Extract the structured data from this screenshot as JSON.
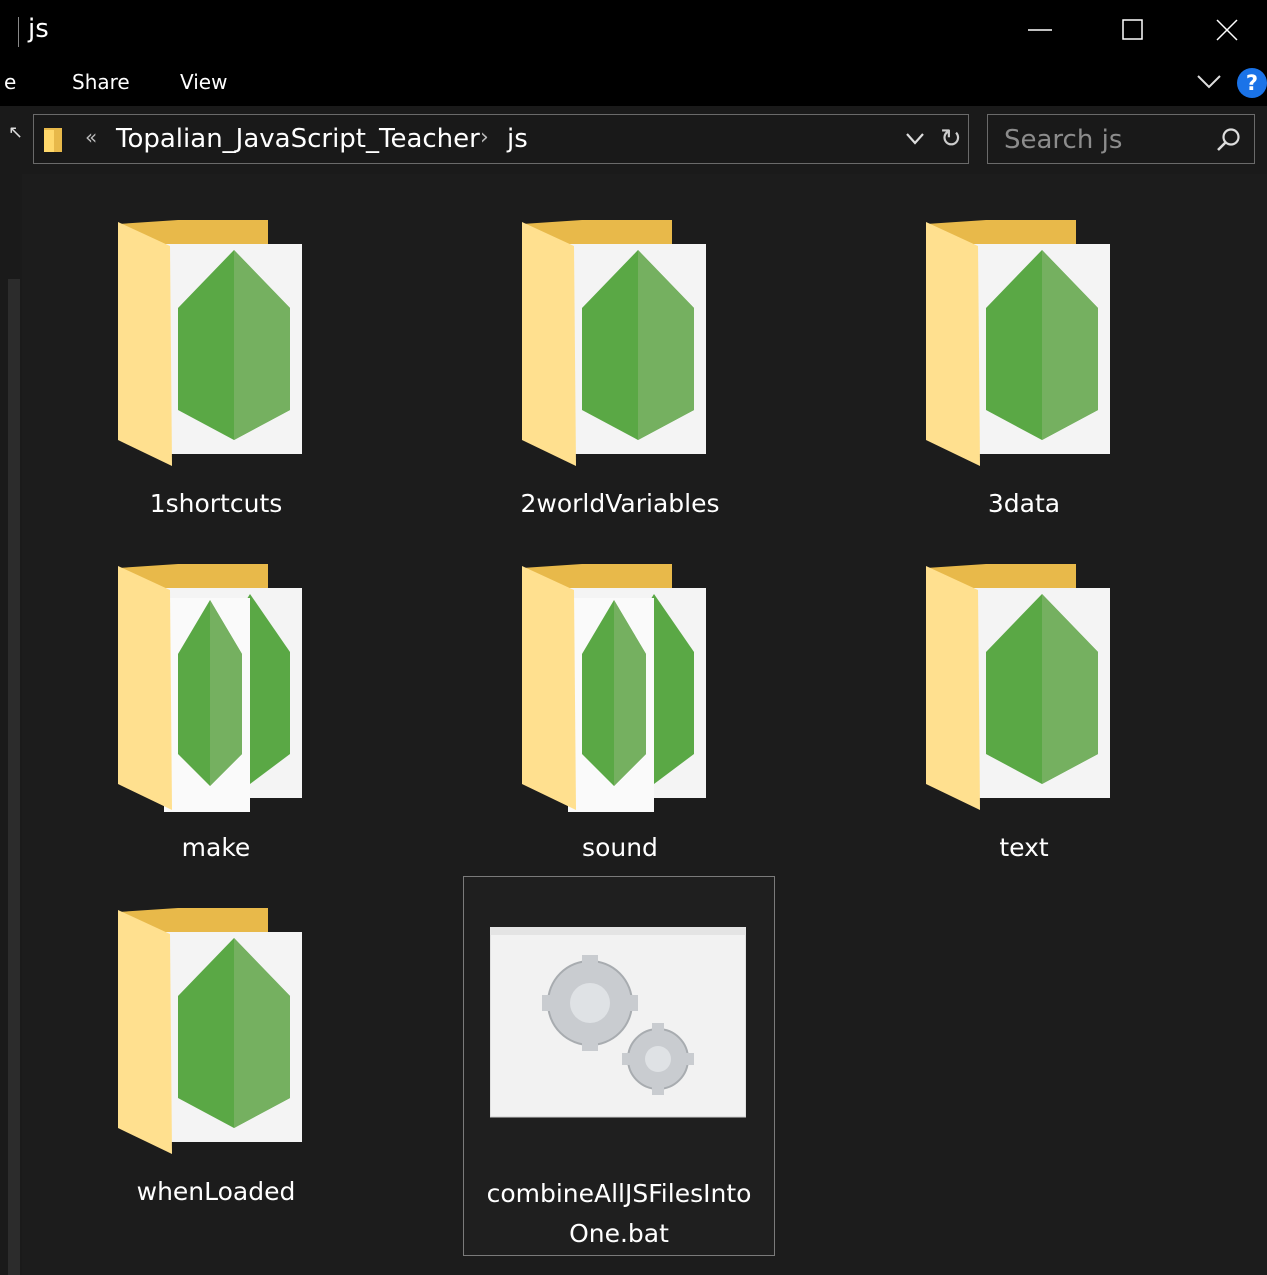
{
  "window": {
    "title": "js",
    "minimize_icon": "minimize-icon",
    "maximize_icon": "maximize-icon",
    "close_icon": "close-icon"
  },
  "ribbon": {
    "tabs": [
      "e",
      "Share",
      "View"
    ]
  },
  "address": {
    "overflow": "«",
    "breadcrumbs": [
      "Topalian_JavaScript_Teacher",
      "js"
    ],
    "separator": "›",
    "refresh": "↻"
  },
  "search": {
    "placeholder": "Search js"
  },
  "colors": {
    "folder_back": "#e8b94a",
    "folder_front": "#ffe08f",
    "node_green": "#5aa845",
    "accent_help": "#1a73e8"
  },
  "items": [
    {
      "name": "1shortcuts",
      "type": "folder-node"
    },
    {
      "name": "2worldVariables",
      "type": "folder-node"
    },
    {
      "name": "3data",
      "type": "folder-node"
    },
    {
      "name": "make",
      "type": "folder-node-multi"
    },
    {
      "name": "sound",
      "type": "folder-node-multi"
    },
    {
      "name": "text",
      "type": "folder-node"
    },
    {
      "name": "whenLoaded",
      "type": "folder-node"
    },
    {
      "name_line1": "combineAllJSFilesInto",
      "name_line2": "One.bat",
      "type": "batch-file"
    }
  ]
}
